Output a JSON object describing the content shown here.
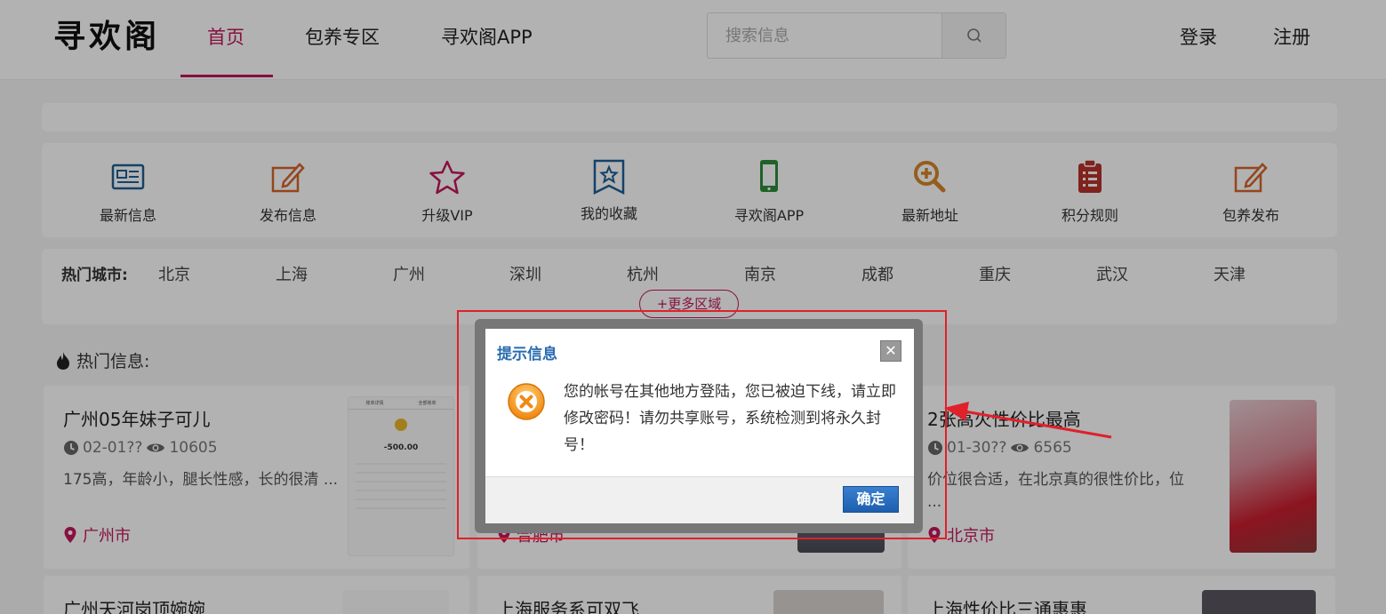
{
  "header": {
    "logo": "寻欢阁",
    "nav": [
      "首页",
      "包养专区",
      "寻欢阁APP"
    ],
    "search_placeholder": "搜索信息",
    "login": "登录",
    "register": "注册"
  },
  "quick_menu": [
    {
      "label": "最新信息",
      "icon": "news-card-icon",
      "color": "#1e5f96"
    },
    {
      "label": "发布信息",
      "icon": "edit-icon",
      "color": "#d4652a"
    },
    {
      "label": "升级VIP",
      "icon": "star-icon",
      "color": "#c2185b"
    },
    {
      "label": "我的收藏",
      "icon": "bookmark-star-icon",
      "color": "#1e5f96"
    },
    {
      "label": "寻欢阁APP",
      "icon": "phone-icon",
      "color": "#2e8b3a"
    },
    {
      "label": "最新地址",
      "icon": "zoom-in-icon",
      "color": "#d4862a"
    },
    {
      "label": "积分规则",
      "icon": "clipboard-icon",
      "color": "#b8322a"
    },
    {
      "label": "包养发布",
      "icon": "edit-icon",
      "color": "#d4652a"
    }
  ],
  "cities": {
    "title": "热门城市:",
    "list": [
      "北京",
      "上海",
      "广州",
      "深圳",
      "杭州",
      "南京",
      "成都",
      "重庆",
      "武汉",
      "天津"
    ],
    "more": "+更多区域"
  },
  "hot": {
    "title": "热门信息:",
    "cards": [
      {
        "title": "广州05年妹子可儿",
        "date": "02-01??",
        "views": "10605",
        "desc": "175高，年龄小，腿长性感，长的很清 ...",
        "location": "广州市"
      },
      {
        "title": "",
        "date": "",
        "views": "",
        "desc": "",
        "location": "合肥市"
      },
      {
        "title": "2张高火性价比最高",
        "date": "01-30??",
        "views": "6565",
        "desc": "价位很合适，在北京真的很性价比，位 ...",
        "location": "北京市"
      },
      {
        "title": "广州天河岗顶婉婉",
        "date": "",
        "views": "",
        "desc": "",
        "location": ""
      },
      {
        "title": "上海服务系可双飞",
        "date": "",
        "views": "",
        "desc": "",
        "location": ""
      },
      {
        "title": "上海性价比三通惠惠",
        "date": "",
        "views": "",
        "desc": "",
        "location": ""
      }
    ],
    "receipt": {
      "header_left": "账单详情",
      "header_right": "全部账单",
      "amount": "-500.00"
    }
  },
  "dialog": {
    "title": "提示信息",
    "close": "✕",
    "message": "您的帐号在其他地方登陆，您已被迫下线，请立即修改密码！请勿共享账号，系统检测到将永久封号！",
    "ok": "确定"
  },
  "colors": {
    "brand": "#c2185b",
    "dialog_title": "#2a6bb0",
    "highlight": "#e0202a"
  }
}
